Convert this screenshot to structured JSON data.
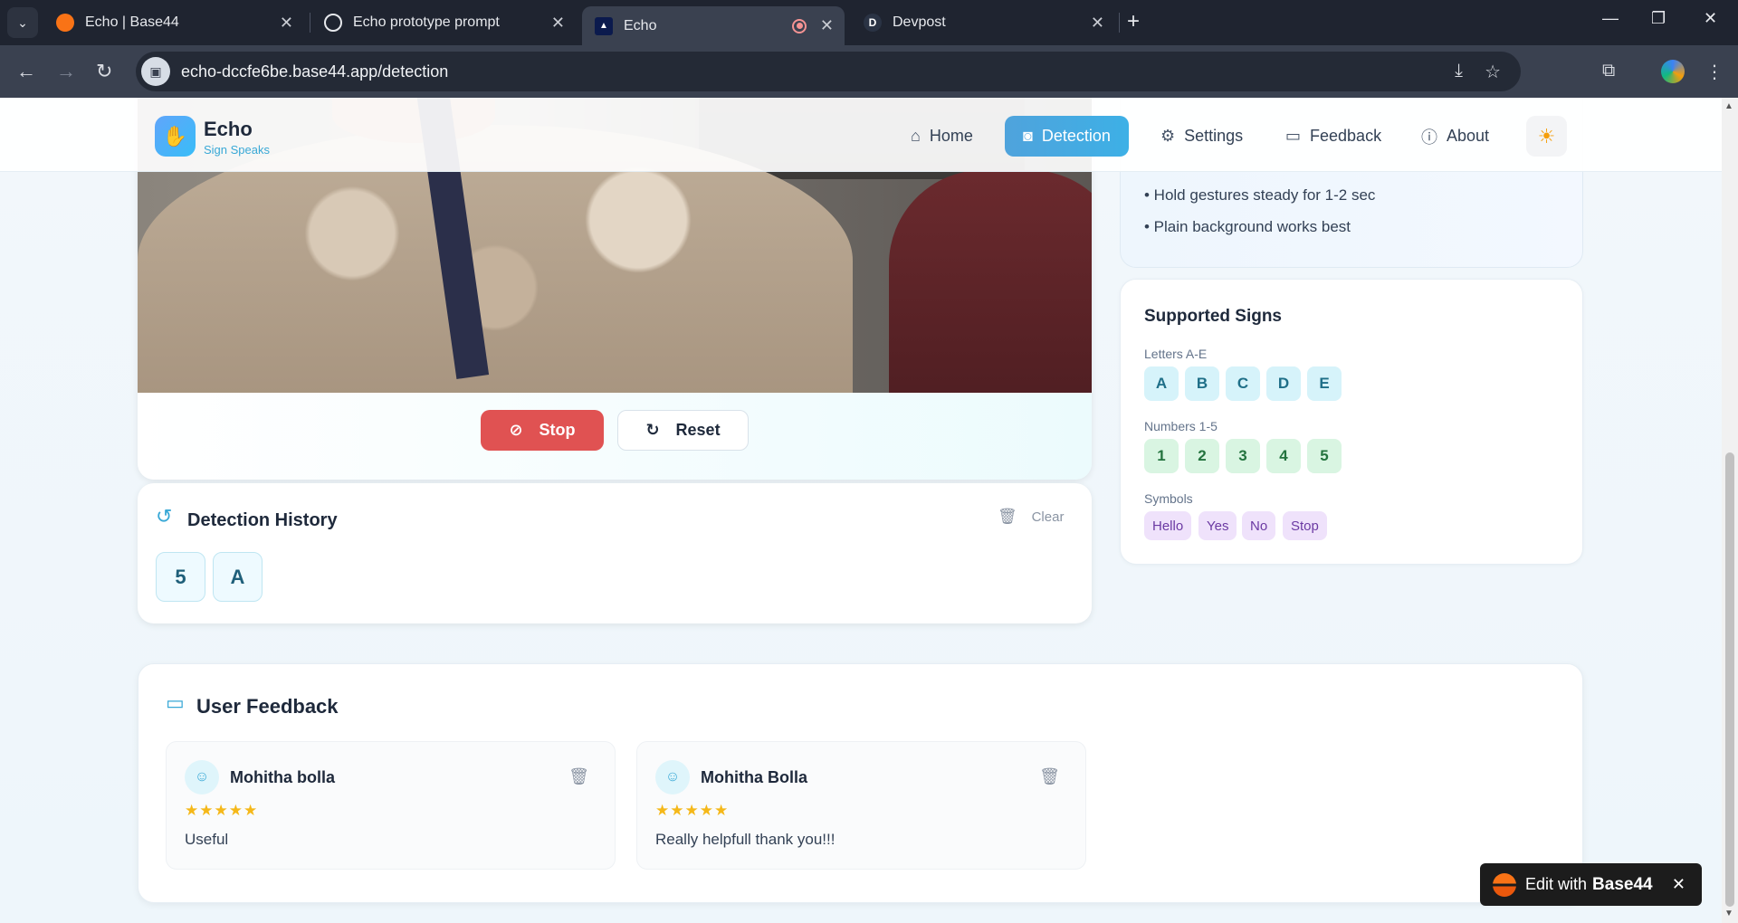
{
  "browser": {
    "tabs": [
      {
        "title": "Echo | Base44",
        "favicon": "base44-icon"
      },
      {
        "title": "Echo prototype prompt",
        "favicon": "chatgpt-icon"
      },
      {
        "title": "Echo",
        "favicon": "echo-icon",
        "active": true
      },
      {
        "title": "Devpost",
        "favicon": "devpost-icon"
      }
    ],
    "url": "echo-dccfe6be.base44.app/detection"
  },
  "header": {
    "brand": "Echo",
    "tagline": "Sign Speaks",
    "nav": [
      {
        "label": "Home",
        "icon": "home-icon"
      },
      {
        "label": "Detection",
        "icon": "camera-icon",
        "active": true
      },
      {
        "label": "Settings",
        "icon": "gear-icon"
      },
      {
        "label": "Feedback",
        "icon": "message-icon"
      },
      {
        "label": "About",
        "icon": "info-icon"
      }
    ]
  },
  "controls": {
    "stop_label": "Stop",
    "reset_label": "Reset"
  },
  "history": {
    "title": "Detection History",
    "clear_label": "Clear",
    "items": [
      "5",
      "A"
    ]
  },
  "tips": {
    "items": [
      "• Hold gestures steady for 1-2 sec",
      "• Plain background works best"
    ]
  },
  "signs": {
    "title": "Supported Signs",
    "letters_label": "Letters A-E",
    "letters": [
      "A",
      "B",
      "C",
      "D",
      "E"
    ],
    "numbers_label": "Numbers 1-5",
    "numbers": [
      "1",
      "2",
      "3",
      "4",
      "5"
    ],
    "symbols_label": "Symbols",
    "symbols": [
      "Hello",
      "Yes",
      "No",
      "Stop"
    ]
  },
  "feedback": {
    "title": "User Feedback",
    "items": [
      {
        "name": "Mohitha bolla",
        "stars": "★★★★★",
        "text": "Useful"
      },
      {
        "name": "Mohitha Bolla",
        "stars": "★★★★★",
        "text": "Really helpfull thank you!!!"
      }
    ]
  },
  "badge": {
    "prefix": "Edit with",
    "brand": "Base44"
  },
  "colors": {
    "accent": "#3db0e6",
    "stop": "#e05252",
    "star": "#f5b819"
  }
}
